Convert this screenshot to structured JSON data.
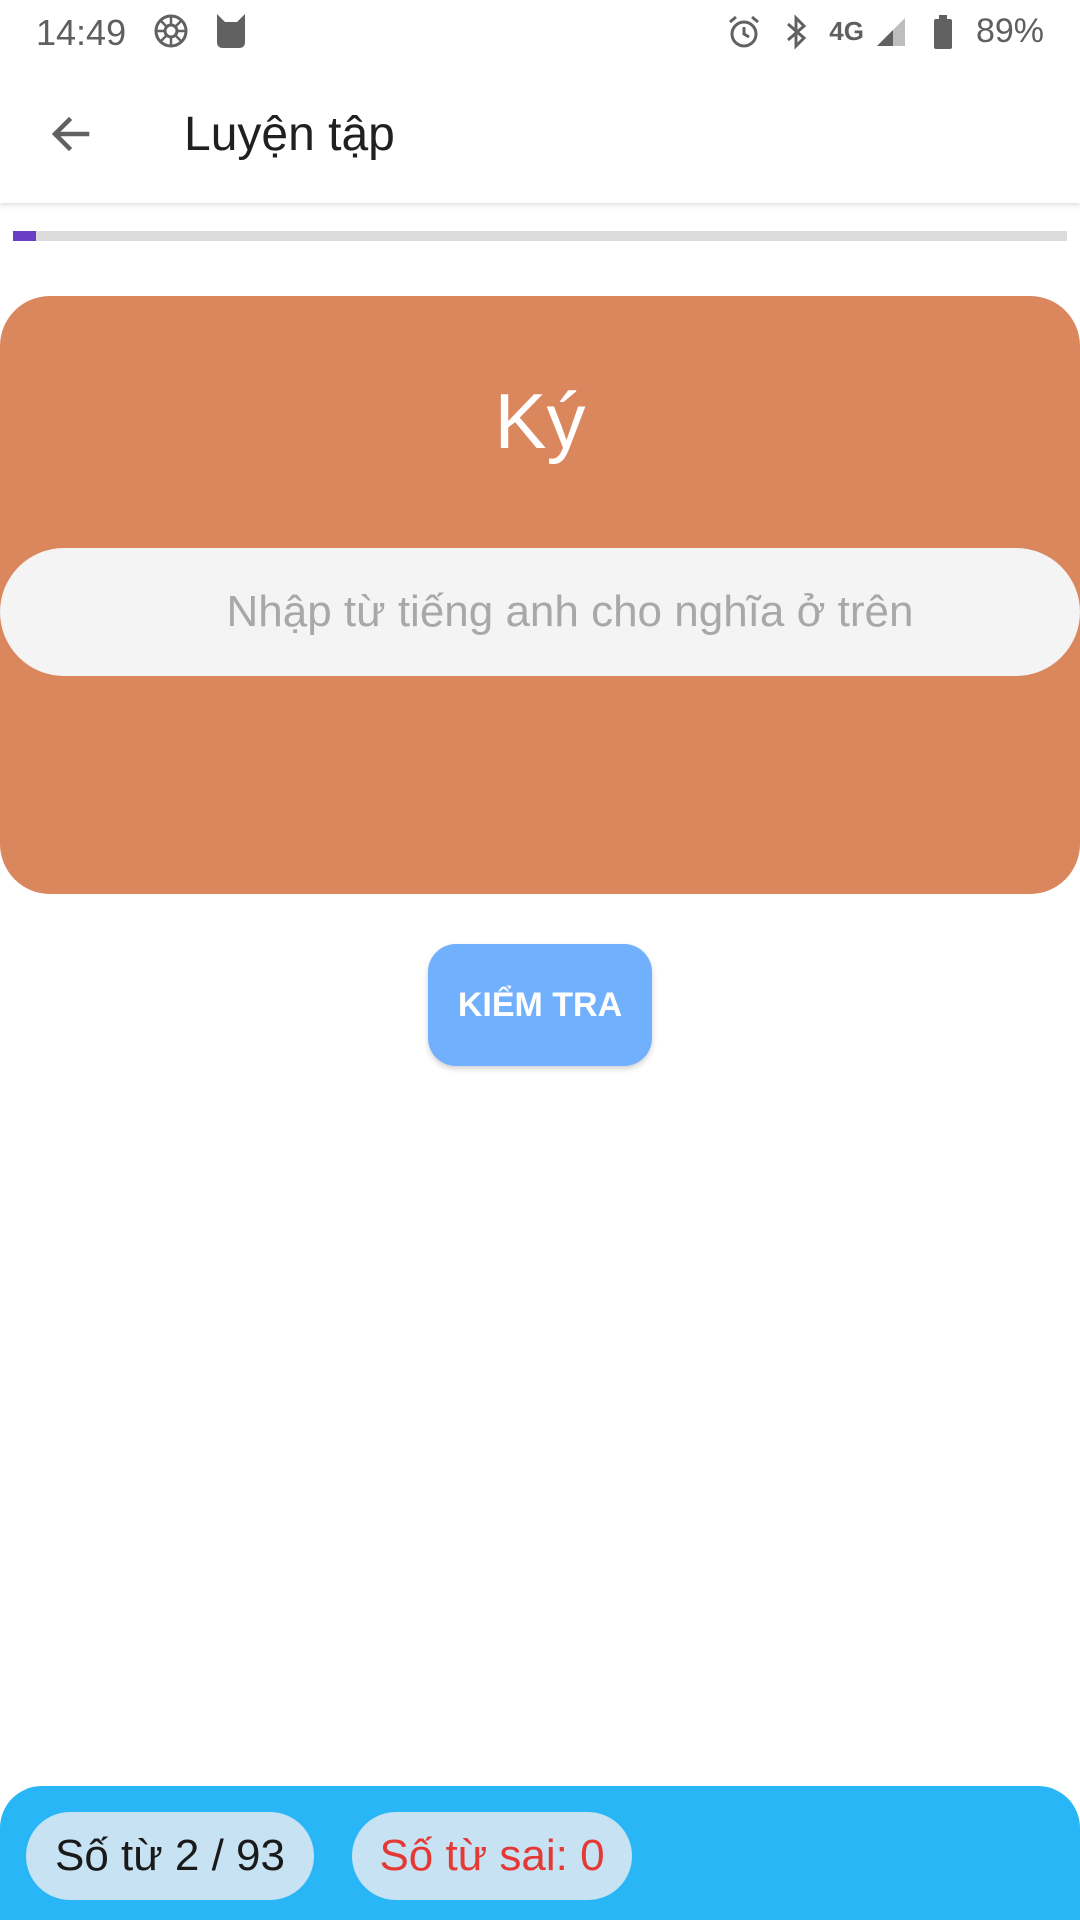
{
  "status_bar": {
    "time": "14:49",
    "network": "4G",
    "battery": "89%",
    "icons": [
      "settings-icon",
      "cat-app-icon",
      "alarm-icon",
      "bluetooth-icon",
      "signal-icon",
      "battery-icon"
    ]
  },
  "app_bar": {
    "title": "Luyện tập",
    "back_icon": "arrow-back-icon"
  },
  "progress": {
    "fraction": 0.0215,
    "fill_color": "#6a3fc6",
    "track_color": "#dcdcdc"
  },
  "quiz": {
    "word": "Ký",
    "input_value": "",
    "input_placeholder": "Nhập từ tiếng anh cho nghĩa ở trên",
    "card_color": "#da875e"
  },
  "check_button": {
    "label": "KIỂM TRA",
    "color": "#71b0fd"
  },
  "footer": {
    "word_count": "Số từ 2 / 93",
    "wrong_count": "Số từ sai: 0",
    "bar_color": "#29b6f6",
    "wrong_color": "#e53935"
  }
}
